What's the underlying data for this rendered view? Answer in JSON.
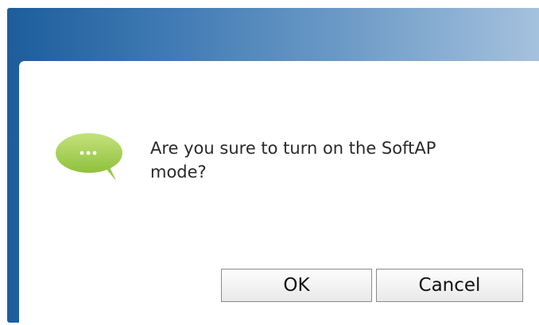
{
  "dialog": {
    "message": "Are you sure to turn on the SoftAP mode?",
    "icon": "speech-bubble-icon",
    "ok_label": "OK",
    "cancel_label": "Cancel"
  },
  "colors": {
    "title_gradient_start": "#1d5d9c",
    "title_gradient_end": "#a5c1dd",
    "icon_green": "#a6cf57"
  }
}
